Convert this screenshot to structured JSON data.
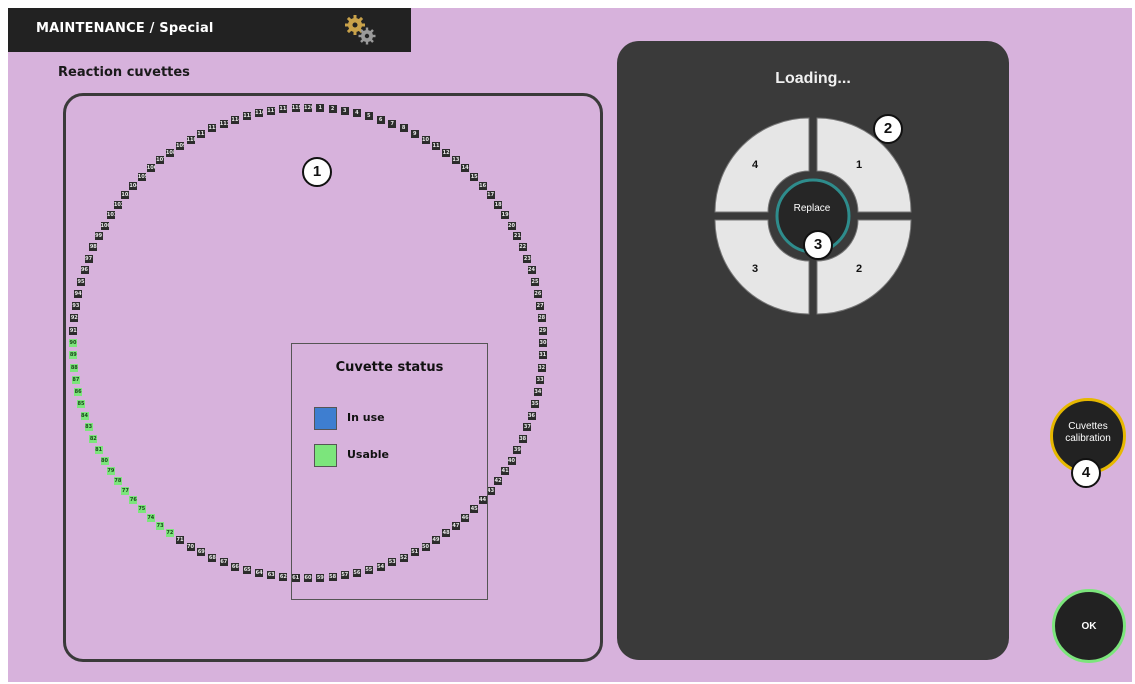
{
  "header": {
    "title": "MAINTENANCE / Special",
    "icon": "gears-icon"
  },
  "section": {
    "label": "Reaction cuvettes"
  },
  "legend": {
    "title": "Cuvette status",
    "items": [
      {
        "label": "In use",
        "color": "#3e7ed0"
      },
      {
        "label": "Usable",
        "color": "#7ce57c"
      }
    ]
  },
  "loading_panel": {
    "status": "Loading...",
    "replace_label": "Replace",
    "quadrants": [
      "1",
      "2",
      "3",
      "4"
    ]
  },
  "buttons": {
    "calibration_label": "Cuvettes calibration",
    "ok_label": "OK"
  },
  "callouts": [
    "1",
    "2",
    "3",
    "4"
  ],
  "cuvettes": {
    "count": 120,
    "usable": [
      72,
      73,
      74,
      75,
      76,
      77,
      78,
      79,
      80,
      81,
      82,
      83,
      84,
      85,
      86,
      87,
      88,
      89,
      90
    ],
    "in_use": []
  },
  "colors": {
    "background": "#d7b2dc",
    "titlebar": "#222222",
    "panel": "#3a3a3a",
    "usable": "#7ce57c",
    "in_use": "#3e7ed0",
    "calibration_ring": "#e6b800",
    "ok_ring": "#7ce57c"
  }
}
